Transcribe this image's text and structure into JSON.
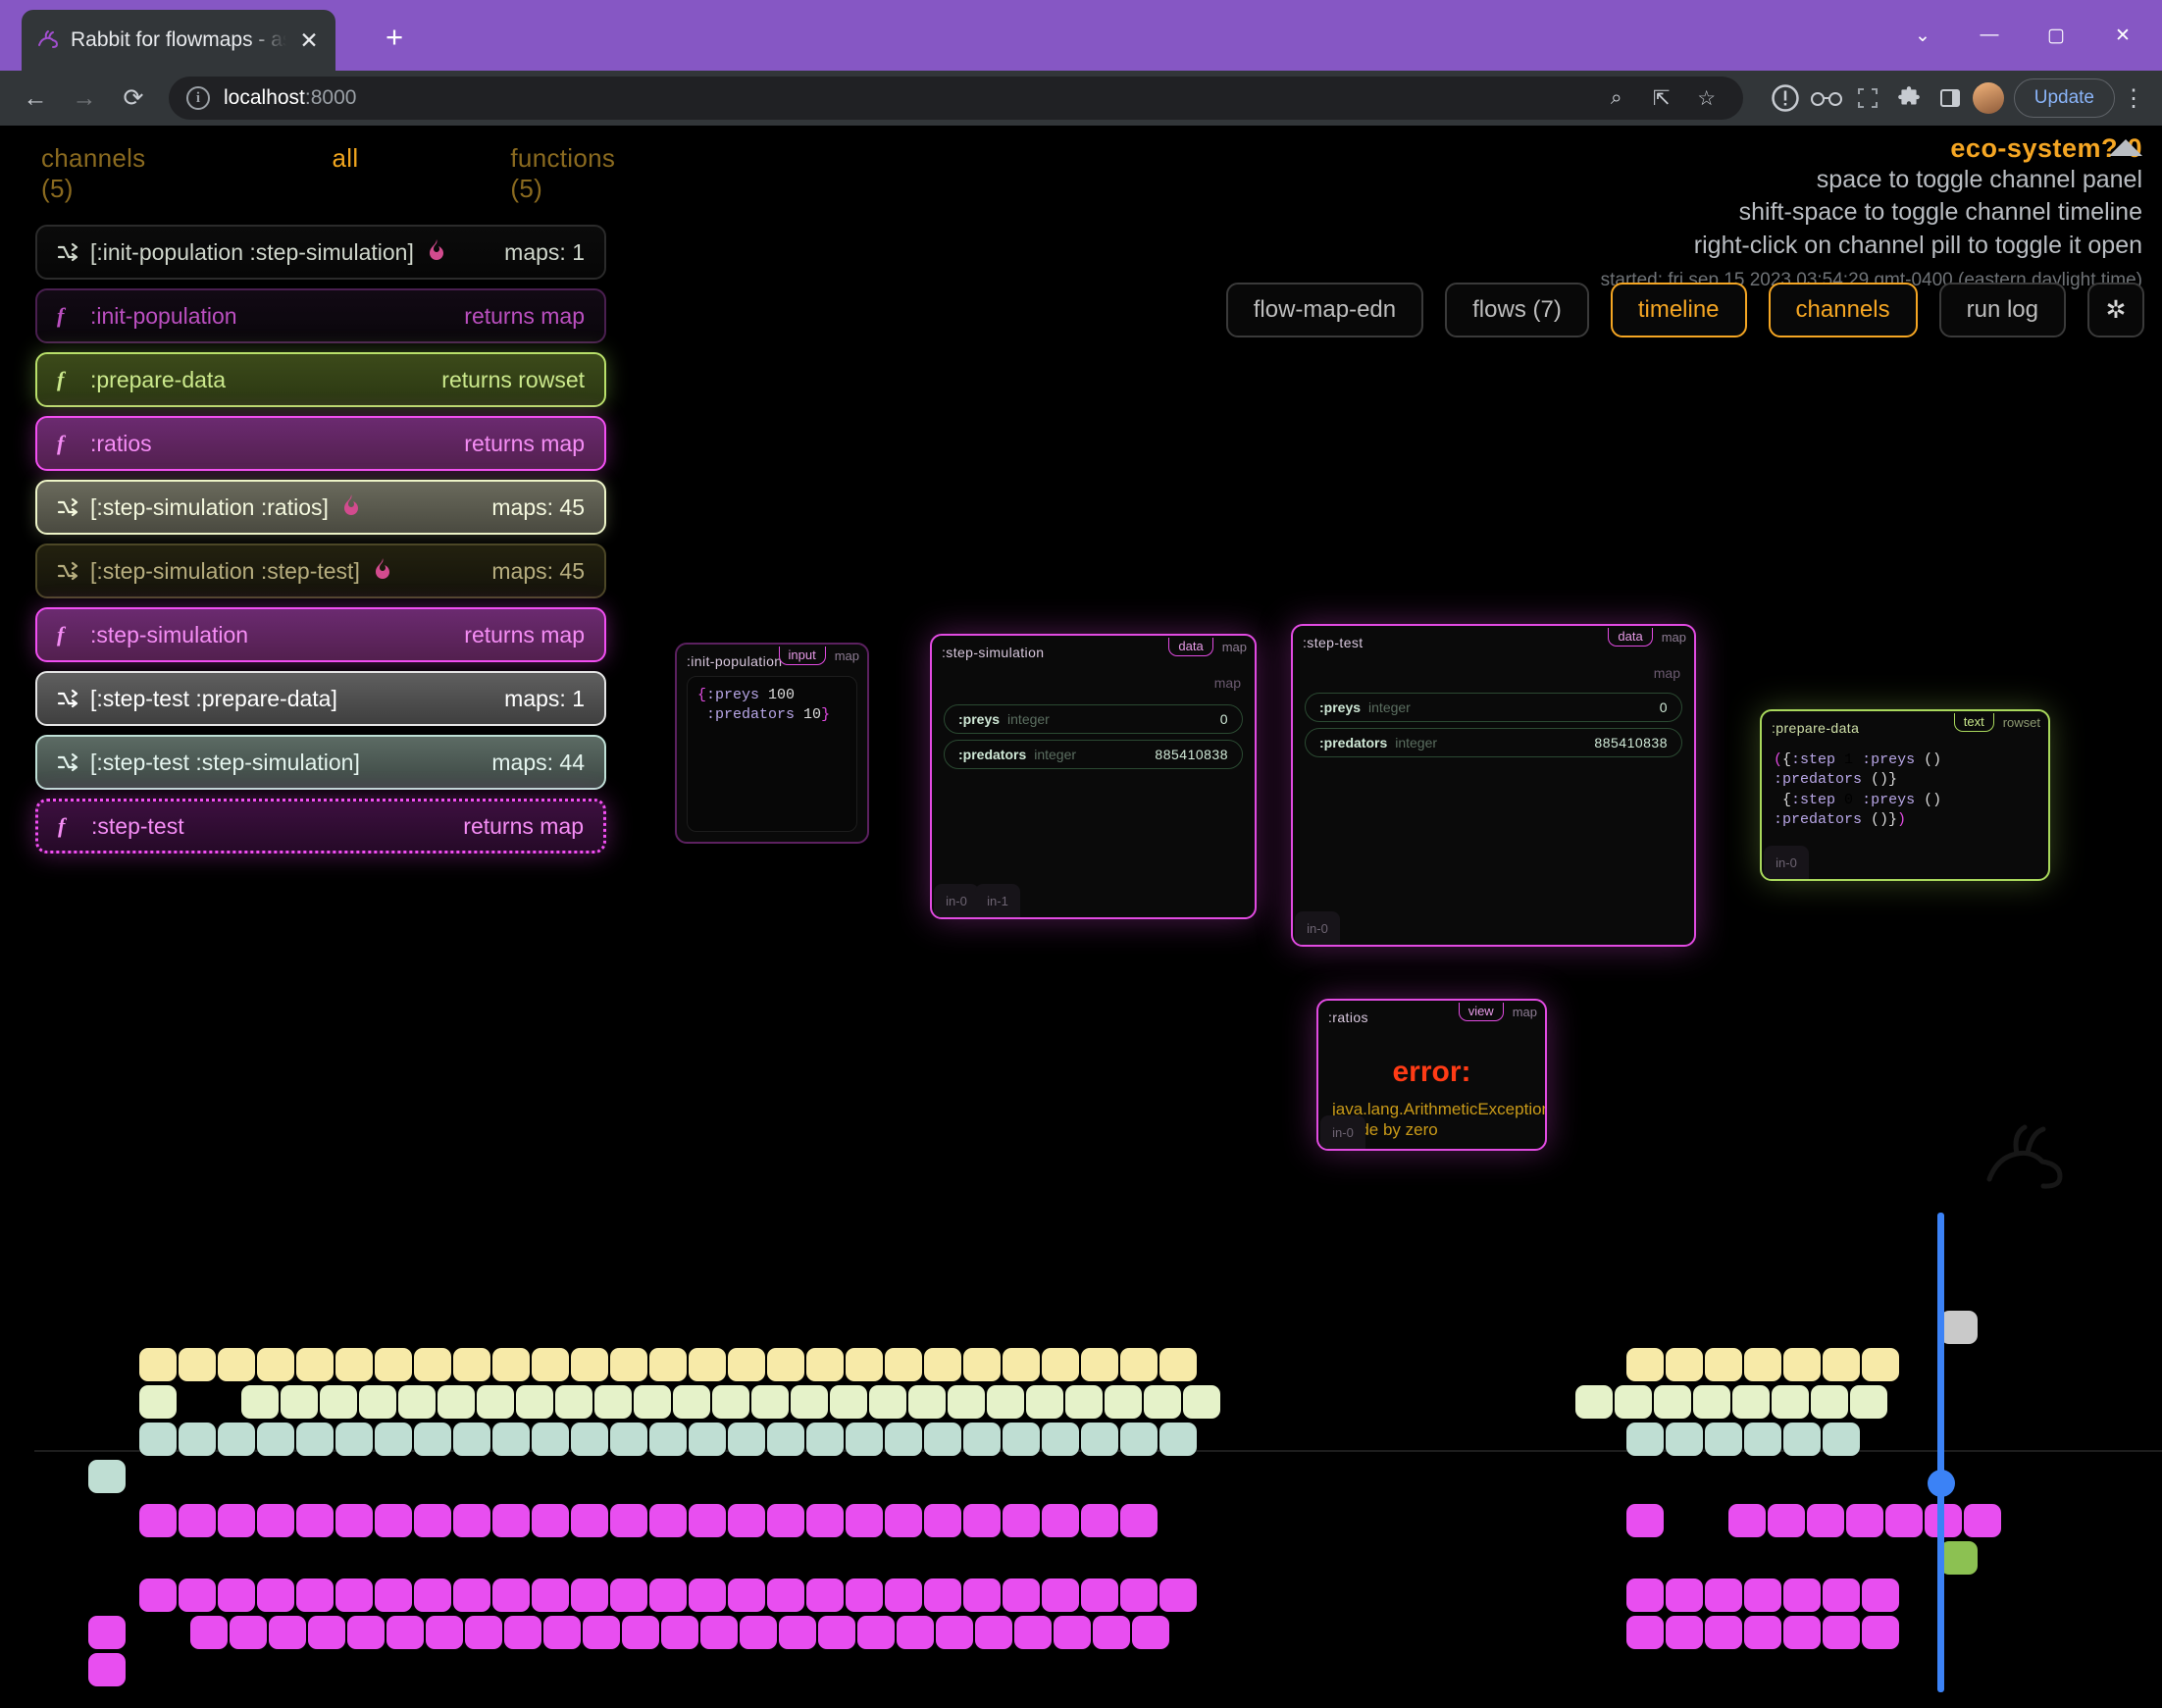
{
  "browser": {
    "tab_title": "Rabbit for flowmaps - async flow",
    "tab_close_label": "✕",
    "new_tab_label": "+",
    "back_label": "←",
    "forward_label": "→",
    "reload_label": "⟳",
    "info_label": "i",
    "url_host": "localhost",
    "url_port": ":8000",
    "zoom_icon_label": "⌕",
    "share_icon_label": "⇱",
    "bookmark_icon_label": "☆",
    "profile_icon_label": "!",
    "glasses_icon_label": "oo",
    "fullscreen_icon_label": "⛶",
    "extensions_icon_label": "🧩",
    "sidepanel_icon_label": "▥",
    "update_label": "Update",
    "menu_label": "⋮",
    "minimize_label": "—",
    "maximize_label": "▢",
    "close_label": "✕",
    "chevron_label": "⌄"
  },
  "panel": {
    "channels_label": "channels (5)",
    "all_label": "all",
    "functions_label": "functions (5)",
    "pills": [
      {
        "icon": "shuffle",
        "label": "[:init-population :step-simulation]",
        "fire": true,
        "right": "maps: 1",
        "style": "c-dark"
      },
      {
        "icon": "fn",
        "label": ":init-population",
        "fire": false,
        "right": "returns map",
        "style": "c-purple"
      },
      {
        "icon": "fn",
        "label": ":prepare-data",
        "fire": false,
        "right": "returns rowset",
        "style": "c-green"
      },
      {
        "icon": "fn",
        "label": ":ratios",
        "fire": false,
        "right": "returns map",
        "style": "c-magenta"
      },
      {
        "icon": "shuffle",
        "label": "[:step-simulation :ratios]",
        "fire": true,
        "right": "maps: 45",
        "style": "c-cream"
      },
      {
        "icon": "shuffle",
        "label": "[:step-simulation :step-test]",
        "fire": true,
        "right": "maps: 45",
        "style": "c-olive"
      },
      {
        "icon": "fn",
        "label": ":step-simulation",
        "fire": false,
        "right": "returns map",
        "style": "c-magenta"
      },
      {
        "icon": "shuffle",
        "label": "[:step-test :prepare-data]",
        "fire": false,
        "right": "maps: 1",
        "style": "c-grey"
      },
      {
        "icon": "shuffle",
        "label": "[:step-test :step-simulation]",
        "fire": false,
        "right": "maps: 44",
        "style": "c-mint"
      },
      {
        "icon": "fn",
        "label": ":step-test",
        "fire": false,
        "right": "returns map",
        "style": "c-dotted"
      }
    ]
  },
  "header": {
    "flow_title": "eco-system?-0",
    "hint1": "space to toggle channel panel",
    "hint2": "shift-space to toggle channel timeline",
    "hint3": "right-click on channel pill to toggle it open",
    "started": "started: fri sep 15 2023 03:54:29 gmt-0400 (eastern daylight time)",
    "accent_color": "#f5a623"
  },
  "toolbar": {
    "buttons": [
      {
        "label": "flow-map-edn",
        "active": false
      },
      {
        "label": "flows (7)",
        "active": false
      },
      {
        "label": "timeline",
        "active": true
      },
      {
        "label": "channels",
        "active": true
      },
      {
        "label": "run log",
        "active": false
      }
    ],
    "gear_label": "✲"
  },
  "flowmap": {
    "nodes": [
      {
        "title": ":init-population",
        "tag_selected": "input",
        "tag_plain": "map",
        "code_line1": "{:preys 100",
        "code_line2": " :predators 10}"
      },
      {
        "title": ":step-simulation",
        "tag_selected": "data",
        "tag_plain": "map",
        "map_label": "map",
        "rows": [
          {
            "key": ":preys",
            "type": "integer",
            "value": "0"
          },
          {
            "key": ":predators",
            "type": "integer",
            "value": "885410838"
          }
        ],
        "ports": [
          "in-0",
          "in-1"
        ]
      },
      {
        "title": ":step-test",
        "tag_selected": "data",
        "tag_plain": "map",
        "map_label": "map",
        "rows": [
          {
            "key": ":preys",
            "type": "integer",
            "value": "0"
          },
          {
            "key": ":predators",
            "type": "integer",
            "value": "885410838"
          }
        ],
        "ports": [
          "in-0"
        ]
      },
      {
        "title": ":prepare-data",
        "tag_selected": "text",
        "tag_plain": "rowset",
        "code_line1": "({:step 1 :preys () :predators ()}",
        "code_line2": " {:step 0 :preys () :predators ()})",
        "ports": [
          "in-0"
        ]
      },
      {
        "title": ":ratios",
        "tag_selected": "view",
        "tag_plain": "map",
        "error_title": "error:",
        "error_message": "java.lang.ArithmeticException: Divide by zero",
        "ports": [
          "in-0"
        ]
      }
    ]
  },
  "timeline": {
    "playhead_color": "#3b82f6",
    "colors": {
      "yellow": "#f7eaa8",
      "pale_green": "#e5f2c9",
      "mint": "#bfded3",
      "magenta": "#e84ef0",
      "grey": "#c9c9c9",
      "olive_green": "#8cc152"
    },
    "rows": [
      {
        "name": "yellow-row",
        "color_key": "yellow"
      },
      {
        "name": "pale-green-row",
        "color_key": "pale_green"
      },
      {
        "name": "mint-row",
        "color_key": "mint"
      },
      {
        "name": "mint-single-row",
        "color_key": "mint"
      },
      {
        "name": "magenta-row-1",
        "color_key": "magenta"
      },
      {
        "name": "magenta-row-2",
        "color_key": "magenta"
      },
      {
        "name": "magenta-row-3",
        "color_key": "magenta"
      },
      {
        "name": "magenta-row-4",
        "color_key": "magenta"
      }
    ]
  }
}
